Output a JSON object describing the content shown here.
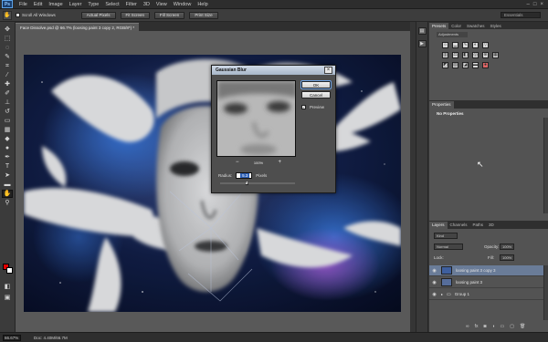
{
  "app": {
    "logo": "Ps"
  },
  "menu": [
    "File",
    "Edit",
    "Image",
    "Layer",
    "Type",
    "Select",
    "Filter",
    "3D",
    "View",
    "Window",
    "Help"
  ],
  "window_controls": {
    "minimize": "–",
    "maximize": "□",
    "close": "×"
  },
  "options_bar": {
    "scroll_all_windows": "Scroll All Windows",
    "buttons": [
      "Actual Pixels",
      "Fit Screen",
      "Fill Screen",
      "Print Size"
    ],
    "workspace": "Essentials"
  },
  "document_tab": {
    "label": "Face Dissolve.psd @ 66.7% (loosing paint 3 copy 2, RGB/8*) *"
  },
  "status": {
    "zoom": "66.67%",
    "doc_size": "Doc: 4.40M/66.7M"
  },
  "panels": {
    "adjustments": {
      "tabs": [
        "Presets",
        "Color",
        "Swatches",
        "Styles"
      ],
      "title": "Adjustments"
    },
    "properties": {
      "tab": "Properties",
      "empty_text": "No Properties"
    },
    "layers": {
      "tabs": [
        "Layers",
        "Channels",
        "Paths",
        "3D"
      ],
      "kind_filter": "Kind",
      "blend_mode": "Normal",
      "opacity_label": "Opacity:",
      "opacity_value": "100%",
      "lock_label": "Lock:",
      "fill_label": "Fill:",
      "fill_value": "100%",
      "items": [
        {
          "name": "loosing paint 3 copy 3",
          "selected": true,
          "type": "pixel"
        },
        {
          "name": "loosing paint 3",
          "selected": false,
          "type": "pixel"
        },
        {
          "name": "Group 1",
          "selected": false,
          "type": "group"
        }
      ]
    }
  },
  "dialog": {
    "title": "Gaussian Blur",
    "close": "×",
    "ok": "OK",
    "cancel": "Cancel",
    "preview_label": "Preview",
    "preview_checked": true,
    "zoom_pct": "100%",
    "zoom_out": "−",
    "zoom_in": "+",
    "radius_label": "Radius:",
    "radius_value": "5.3",
    "radius_unit": "Pixels",
    "radius_slider_fraction": 0.33
  },
  "colors": {
    "foreground": "#e00000",
    "background": "#ffffff",
    "accent": "#6a7c98"
  }
}
